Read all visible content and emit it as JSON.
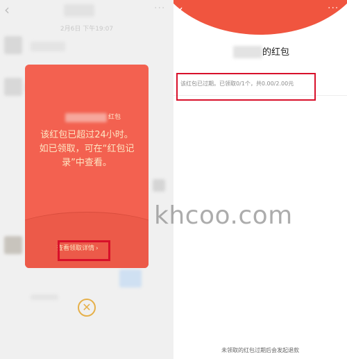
{
  "left_panel": {
    "back_icon": "‹",
    "more_icon": "···",
    "chat_time": "2月6日 下午19:07",
    "red_packet_modal": {
      "sender_suffix": "红包",
      "message_line1": "该红包已超过24小时。",
      "message_line2": "如已领取，可在“红包记",
      "message_line3": "录”中查看。",
      "detail_link_label": "查看领取详情",
      "detail_link_arrow": "›"
    },
    "close_icon": "✕"
  },
  "right_panel": {
    "back_icon": "‹",
    "more_icon": "···",
    "owner_suffix": "的红包",
    "status_text": "该红包已过期。已领取0/1个，共0.00/2.00元",
    "footer_note": "未领取的红包过期后会发起退款"
  },
  "watermark": "khcoo.com",
  "colors": {
    "red_packet": "#f36150",
    "header_red": "#f0553f",
    "gold_text": "#fde6c3",
    "close_gold": "#e6b04a",
    "highlight_box": "#d8102a"
  }
}
